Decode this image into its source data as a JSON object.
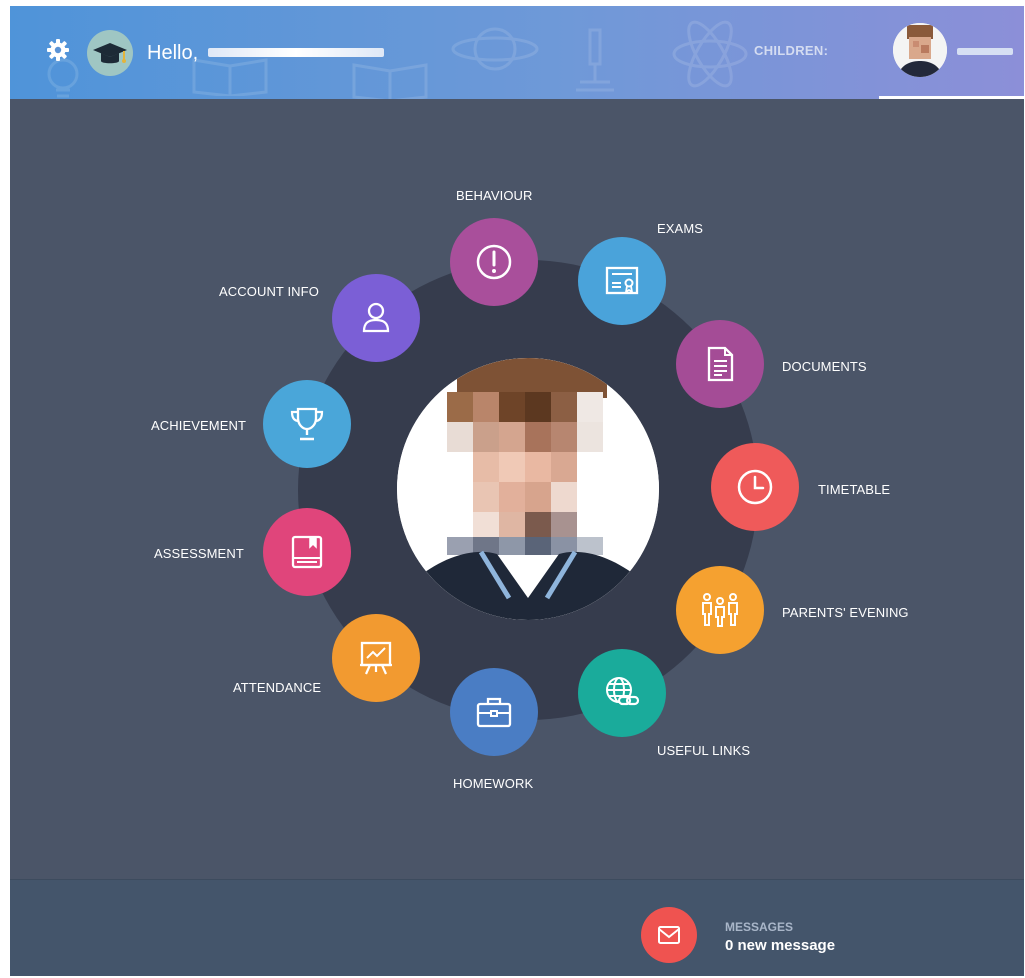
{
  "header": {
    "greeting": "Hello,",
    "children_label": "CHILDREN:"
  },
  "icons": {
    "settings": "gear-icon",
    "logo": "graduation-cap-icon"
  },
  "menu": {
    "behaviour": {
      "label": "BEHAVIOUR",
      "icon": "exclamation-icon",
      "color": "#a94f9b"
    },
    "exams": {
      "label": "EXAMS",
      "icon": "certificate-icon",
      "color": "#4aa3da"
    },
    "documents": {
      "label": "DOCUMENTS",
      "icon": "document-icon",
      "color": "#a44c96"
    },
    "timetable": {
      "label": "TIMETABLE",
      "icon": "clock-icon",
      "color": "#ef5a5a"
    },
    "parents_evening": {
      "label": "PARENTS' EVENING",
      "icon": "people-icon",
      "color": "#f5a130"
    },
    "useful_links": {
      "label": "USEFUL LINKS",
      "icon": "globe-link-icon",
      "color": "#1aab9b"
    },
    "homework": {
      "label": "HOMEWORK",
      "icon": "briefcase-icon",
      "color": "#4a7dc4"
    },
    "attendance": {
      "label": "ATTENDANCE",
      "icon": "presentation-board-icon",
      "color": "#f29a30"
    },
    "assessment": {
      "label": "ASSESSMENT",
      "icon": "book-icon",
      "color": "#e0457b"
    },
    "achievement": {
      "label": "ACHIEVEMENT",
      "icon": "trophy-icon",
      "color": "#4aa6d9"
    },
    "account_info": {
      "label": "ACCOUNT INFO",
      "icon": "user-icon",
      "color": "#7b5fd6"
    }
  },
  "footer": {
    "messages_title": "MESSAGES",
    "messages_count": "0 new message",
    "icon": "envelope-icon",
    "color": "#ef5350"
  },
  "colors": {
    "background": "#4b5568",
    "ring": "#363c4d",
    "footer": "#44556b"
  }
}
